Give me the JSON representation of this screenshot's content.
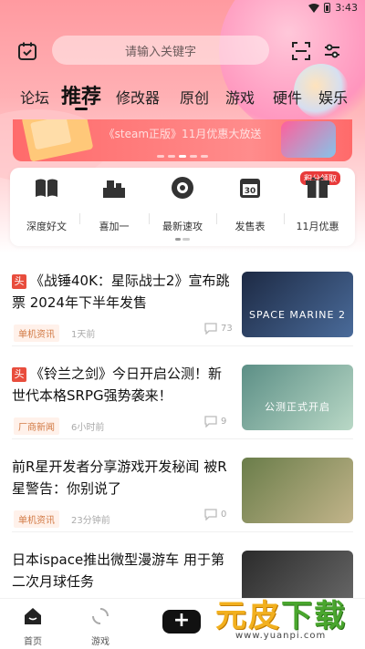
{
  "status_bar": {
    "time": "3:43"
  },
  "search": {
    "placeholder": "请输入关键字"
  },
  "tabs": [
    {
      "label": "论坛"
    },
    {
      "label": "推荐",
      "active": true
    },
    {
      "label": "修改器"
    },
    {
      "label": "原创"
    },
    {
      "label": "游戏"
    },
    {
      "label": "硬件"
    },
    {
      "label": "娱乐"
    }
  ],
  "banner": {
    "text": "《steam正版》11月优惠大放送",
    "page_count": 5,
    "current_page": 3
  },
  "quick_links": {
    "badge": "积分领取",
    "items": [
      {
        "label": "深度好文",
        "icon": "book-icon"
      },
      {
        "label": "喜加一",
        "icon": "blocks-icon"
      },
      {
        "label": "最新速攻",
        "icon": "disc-icon"
      },
      {
        "label": "发售表",
        "icon": "calendar-30-icon"
      },
      {
        "label": "11月优惠",
        "icon": "gift-box-icon"
      }
    ]
  },
  "feed": [
    {
      "head": "头",
      "title": "《战锤40K：星际战士2》宣布跳票 2024年下半年发售",
      "category": "单机资讯",
      "time": "1天前",
      "comments": "73",
      "thumb_caption": "SPACE MARINE 2",
      "thumb_colors": [
        "#1d2a44",
        "#4a6b9a"
      ]
    },
    {
      "head": "头",
      "title": "《铃兰之剑》今日开启公测！新世代本格SRPG强势袭来！",
      "category": "厂商新闻",
      "time": "6小时前",
      "comments": "9",
      "thumb_caption": "公测正式开启",
      "thumb_colors": [
        "#5c8f86",
        "#b9d8c6"
      ]
    },
    {
      "head": "",
      "title": "前R星开发者分享游戏开发秘闻 被R星警告：你别说了",
      "category": "单机资讯",
      "time": "23分钟前",
      "comments": "0",
      "thumb_caption": "",
      "thumb_colors": [
        "#6a7d4a",
        "#c2b48a"
      ]
    },
    {
      "head": "",
      "title": "日本ispace推出微型漫游车 用于第二次月球任务",
      "category": "",
      "time": "",
      "comments": "",
      "thumb_caption": "",
      "thumb_colors": [
        "#2b2b2b",
        "#6b6b6b"
      ]
    }
  ],
  "bottom_nav": [
    {
      "label": "首页",
      "icon": "home-icon"
    },
    {
      "label": "游戏",
      "icon": "game-loop-icon"
    }
  ],
  "watermark": {
    "text_a": "元皮",
    "text_b": "下载",
    "url": "www.yuanpi.com"
  },
  "colors": {
    "accent_red": "#e84d3d",
    "category_orange": "#d27a45",
    "hero_pink": "#ffb0b4"
  }
}
